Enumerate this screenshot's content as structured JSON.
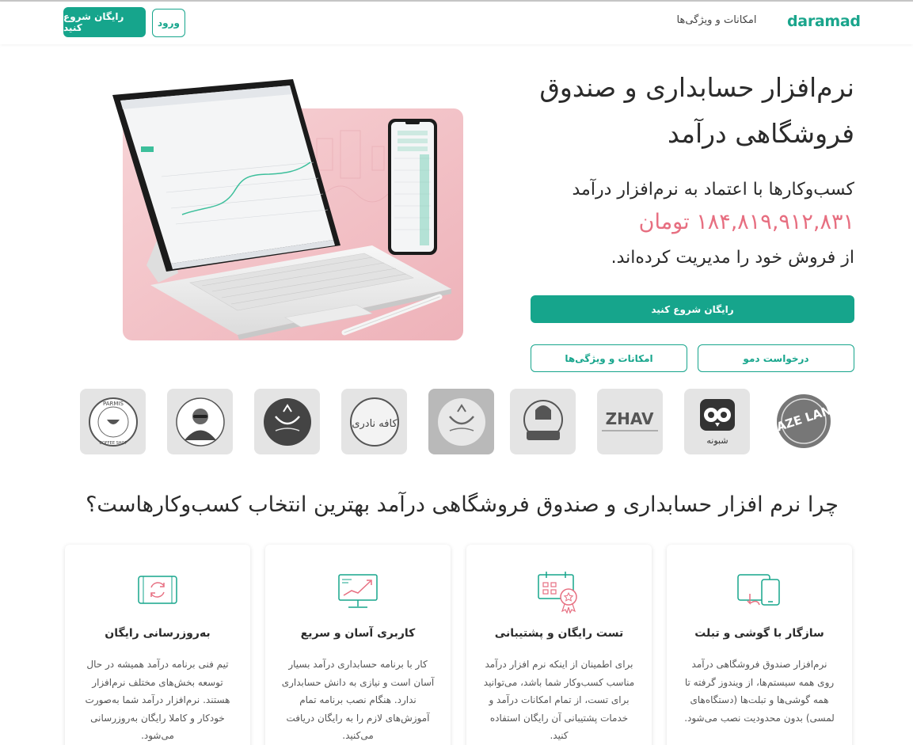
{
  "header": {
    "logo": "daramad",
    "nav_features": "امکانات و ویژگی‌ها",
    "login": "ورود",
    "start_free": "رایگان شروع کنید"
  },
  "hero": {
    "title": "نرم‌افزار حسابداری و صندوق فروشگاهی درآمد",
    "subtitle_1": "کسب‌وکارها با اعتماد به نرم‌افزار درآمد",
    "amount": "۱۸۴,۸۱۹,۹۱۲,۸۳۱ تومان",
    "subtitle_2": "از فروش خود را مدیریت کرده‌اند.",
    "cta_primary": "رایگان شروع کنید",
    "cta_demo": "درخواست دمو",
    "cta_features": "امکانات و ویژگی‌ها"
  },
  "logos": [
    {
      "name": "maze-land-logo",
      "text": "MAZE LAND"
    },
    {
      "name": "shabooneh-logo",
      "text": "شبونه"
    },
    {
      "name": "zhav-logo",
      "text": "ZHAV"
    },
    {
      "name": "cafe-chef-logo",
      "text": ""
    },
    {
      "name": "bowl-logo-light",
      "text": ""
    },
    {
      "name": "cafe-nader-logo",
      "text": "کافه نادری"
    },
    {
      "name": "bowl-logo-dark",
      "text": ""
    },
    {
      "name": "man-portrait-logo",
      "text": ""
    },
    {
      "name": "parmis-logo",
      "text": "PARMIS COFFEE SHOP"
    }
  ],
  "why": {
    "title": "چرا نرم افزار حسابداری و صندوق فروشگاهی درآمد بهترین انتخاب کسب‌وکارهاست؟",
    "cards": [
      {
        "icon": "devices-icon",
        "title": "سازگار با گوشی و تبلت",
        "text": "نرم‌افزار صندوق فروشگاهی درآمد روی همه سیستم‌ها، از ویندوز گرفته تا همه گوشی‌ها و تبلت‌ها (دستگاه‌های لمسی) بدون محدودیت نصب می‌شود."
      },
      {
        "icon": "calendar-badge-icon",
        "title": "تست رایگان و پشتیبانی",
        "text": "برای اطمینان از اینکه نرم افزار درآمد مناسب کسب‌وکار شما باشد، می‌توانید برای تست، از تمام امکانات درآمد و خدمات پشتیبانی آن رایگان استفاده کنید."
      },
      {
        "icon": "chart-monitor-icon",
        "title": "کاربری آسان و سریع",
        "text": "کار با برنامه حسابداری درآمد بسیار آسان است و نیازی به دانش حسابداری ندارد. هنگام نصب برنامه تمام آموزش‌های لازم را به رایگان دریافت می‌کنید."
      },
      {
        "icon": "update-sync-icon",
        "title": "به‌روزرسانی رایگان",
        "text": "تیم فنی برنامه درآمد همیشه در حال توسعه بخش‌های مختلف نرم‌افزار هستند. نرم‌افزار درآمد شما به‌صورت خودکار و کاملا رایگان به‌روزرسانی می‌شود."
      }
    ]
  },
  "colors": {
    "brand": "#16a58c",
    "amount": "#e76f81",
    "hero_bg": "#f2c3c9"
  }
}
